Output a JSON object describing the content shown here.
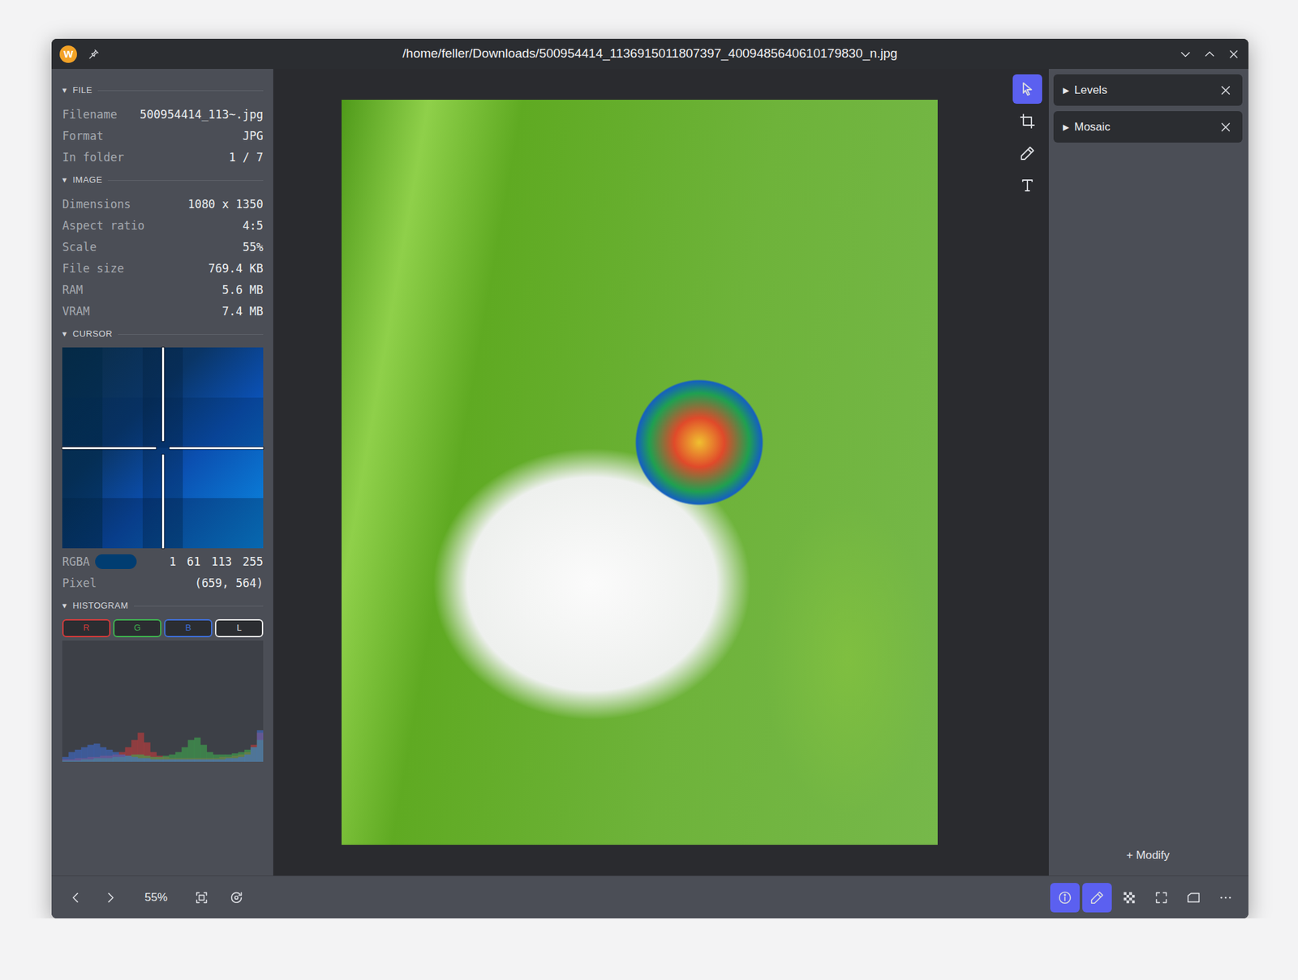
{
  "window": {
    "logo": "W",
    "title": "/home/feller/Downloads/500954414_1136915011807397_4009485640610179830_n.jpg",
    "controls": [
      {
        "kind": "minimize"
      },
      {
        "kind": "maximize"
      },
      {
        "kind": "close"
      }
    ]
  },
  "info_panel": {
    "sections": [
      {
        "toggle": "▾",
        "title": "FILE",
        "expanded": true,
        "rows": [
          {
            "label": "Filename",
            "value": "500954414_113~.jpg"
          },
          {
            "label": "Format",
            "value": "JPG"
          },
          {
            "label": "In folder",
            "value": "1 / 7"
          }
        ]
      },
      {
        "toggle": "▾",
        "title": "IMAGE",
        "expanded": true,
        "rows": [
          {
            "label": "Dimensions",
            "value": "1080 x 1350"
          },
          {
            "label": "Aspect ratio",
            "value": "4:5"
          },
          {
            "label": "Scale",
            "value": "55%"
          },
          {
            "label": "File size",
            "value": "769.4 KB"
          },
          {
            "label": "RAM",
            "value": "5.6 MB"
          },
          {
            "label": "VRAM",
            "value": "7.4 MB"
          }
        ]
      }
    ],
    "cursor": {
      "toggle": "▾",
      "title": "CURSOR",
      "expanded": true,
      "rgba_label": "RGBA",
      "swatch": "#013d71",
      "rgba": [
        "1",
        "61",
        "113",
        "255"
      ],
      "pixel_label": "Pixel",
      "pixel": "(659, 564)"
    },
    "histogram": {
      "toggle": "▾",
      "title": "HISTOGRAM",
      "expanded": true,
      "channels": [
        {
          "label": "R",
          "color": "#d23b3b",
          "selected": false,
          "values": [
            2,
            2,
            3,
            3,
            4,
            4,
            5,
            5,
            6,
            8,
            12,
            18,
            24,
            16,
            8,
            5,
            4,
            3,
            3,
            3,
            3,
            3,
            3,
            3,
            3,
            4,
            4,
            5,
            6,
            8,
            14,
            24
          ]
        },
        {
          "label": "G",
          "color": "#3fb34f",
          "selected": false,
          "values": [
            1,
            1,
            1,
            2,
            2,
            3,
            3,
            3,
            4,
            4,
            5,
            6,
            6,
            5,
            4,
            4,
            5,
            6,
            8,
            12,
            18,
            20,
            14,
            8,
            6,
            6,
            6,
            7,
            8,
            10,
            12,
            18
          ]
        },
        {
          "label": "B",
          "color": "#3f6fd8",
          "selected": false,
          "values": [
            4,
            8,
            10,
            12,
            14,
            15,
            12,
            10,
            8,
            6,
            5,
            4,
            3,
            3,
            2,
            2,
            2,
            2,
            2,
            2,
            2,
            2,
            2,
            2,
            2,
            2,
            3,
            3,
            4,
            6,
            12,
            26
          ]
        },
        {
          "label": "L",
          "color": "#e4e4e4",
          "selected": false
        }
      ]
    }
  },
  "tools": [
    {
      "kind": "pointer",
      "selected": true
    },
    {
      "kind": "crop",
      "selected": false
    },
    {
      "kind": "draw",
      "selected": false
    },
    {
      "kind": "text",
      "selected": false
    }
  ],
  "modifiers": {
    "items": [
      {
        "toggle": "▶",
        "label": "Levels",
        "expanded": false
      },
      {
        "toggle": "▶",
        "label": "Mosaic",
        "expanded": false
      }
    ],
    "add_label": "+ Modify"
  },
  "status_bar": {
    "nav": [
      {
        "kind": "previous"
      },
      {
        "kind": "next"
      }
    ],
    "zoom": "55%",
    "view_buttons": [
      {
        "kind": "fit"
      },
      {
        "kind": "reset"
      }
    ],
    "panel_buttons": [
      {
        "kind": "info",
        "selected": true
      },
      {
        "kind": "edit",
        "selected": true
      },
      {
        "kind": "transparency",
        "selected": false
      },
      {
        "kind": "fullscreen",
        "selected": false
      },
      {
        "kind": "sidebar",
        "selected": false
      },
      {
        "kind": "more",
        "selected": false
      }
    ]
  }
}
